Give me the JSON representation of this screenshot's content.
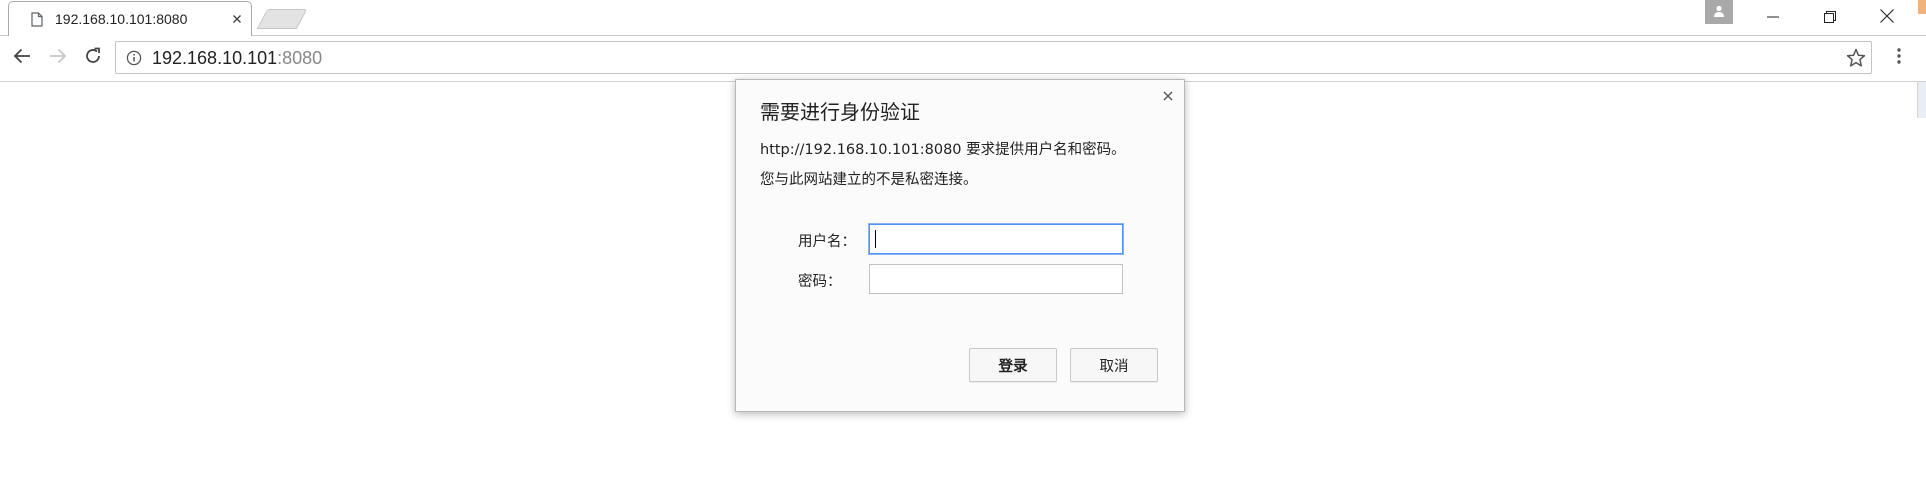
{
  "browser": {
    "tab": {
      "title": "192.168.10.101:8080",
      "icon": "page-icon",
      "close_icon": "close-icon"
    },
    "window_controls": [
      "minimize-icon",
      "restore-icon",
      "close-icon"
    ],
    "profile_icon": "person-icon",
    "address_bar": {
      "host": "192.168.10.101",
      "port": ":8080",
      "security_icon": "info-icon",
      "bookmark_icon": "star-icon"
    },
    "nav": [
      "back-arrow-icon",
      "forward-arrow-icon",
      "reload-icon"
    ],
    "menu_icon": "vertical-dots-icon"
  },
  "dialog": {
    "title": "需要进行身份验证",
    "message_line1": "http://192.168.10.101:8080 要求提供用户名和密码。",
    "message_line2": "您与此网站建立的不是私密连接。",
    "username_label": "用户名：",
    "password_label": "密码：",
    "username_value": "",
    "password_value": "",
    "login_button": "登录",
    "cancel_button": "取消",
    "close_icon": "close-icon"
  },
  "colors": {
    "focus_border": "#4d90fe",
    "url_port": "#888888",
    "forward_disabled": "#c6c6c6"
  }
}
